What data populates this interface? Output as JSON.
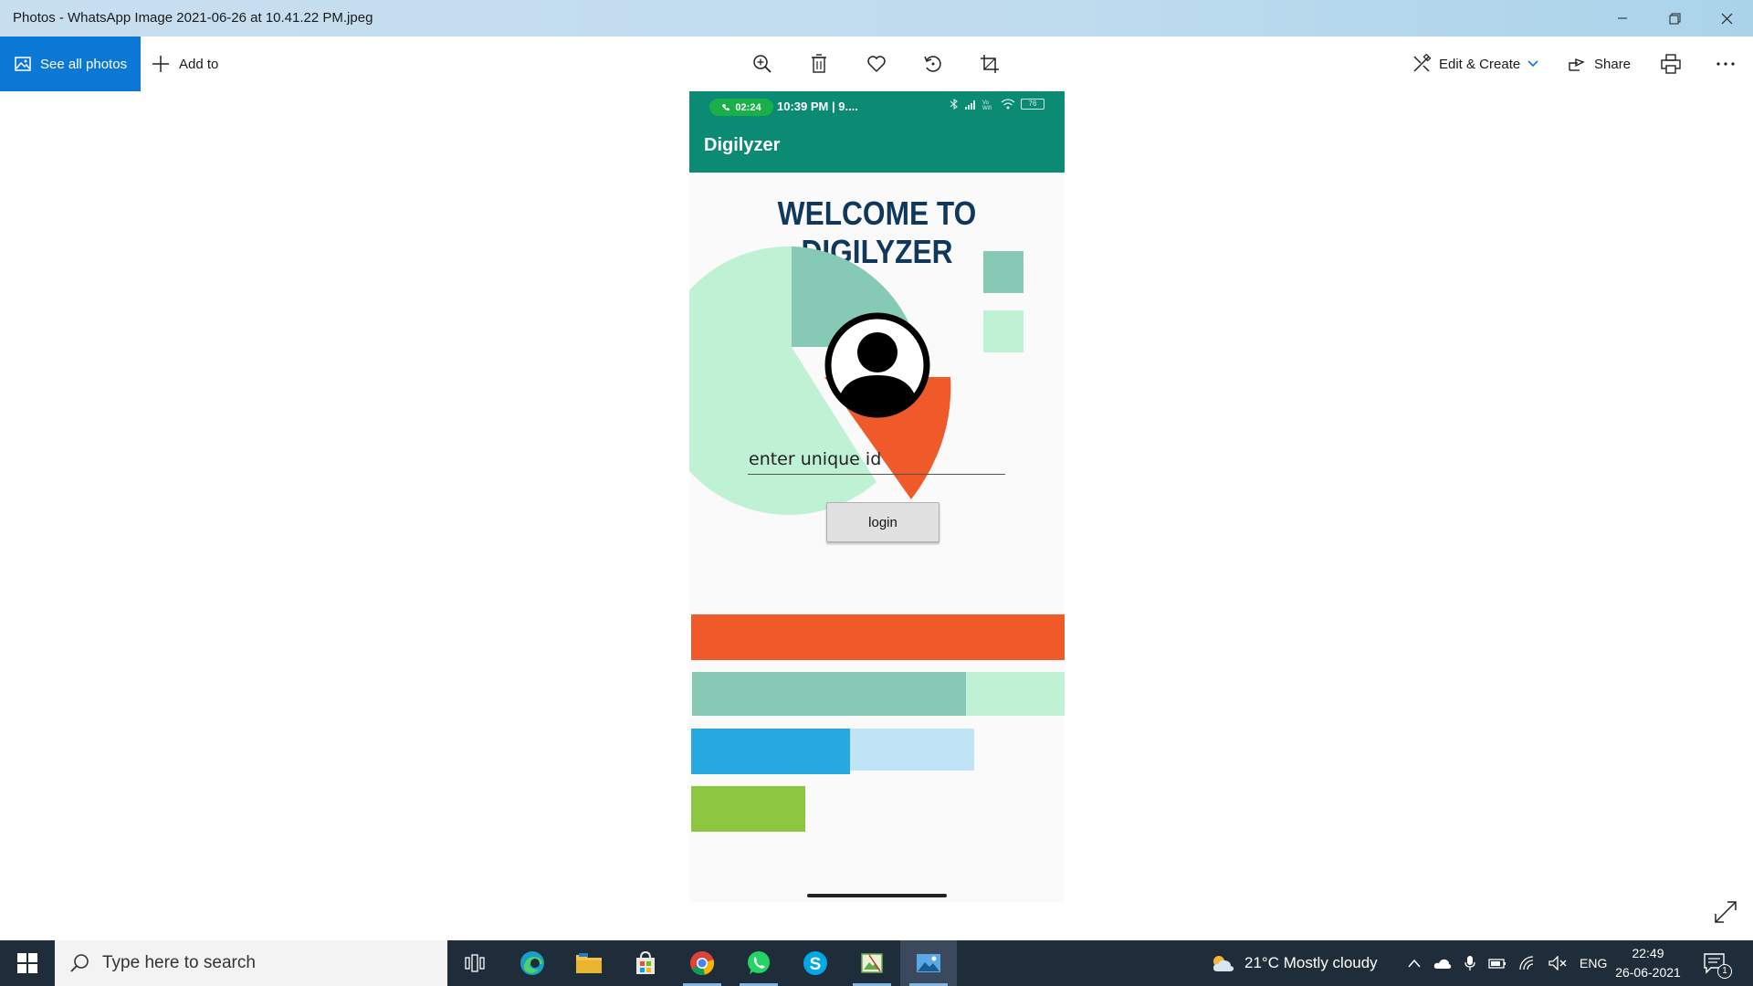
{
  "window": {
    "title": "Photos - WhatsApp Image 2021-06-26 at 10.41.22 PM.jpeg"
  },
  "toolbar": {
    "see_all_photos": "See all photos",
    "add_to": "Add to",
    "edit_create": "Edit & Create",
    "share": "Share"
  },
  "phone": {
    "call_timer": "02:24",
    "status_time": "10:39 PM | 9....",
    "battery": "76",
    "app_title": "Digilyzer",
    "welcome": "WELCOME TO DIGILYZER",
    "uid_placeholder": "enter unique id",
    "login_label": "login",
    "colors": {
      "teal": "#0b8a74",
      "orange": "#f05a2a",
      "mint": "#86c9b4",
      "light_mint": "#bff2d4",
      "blue": "#27a8e0",
      "light_blue": "#bfe4f6",
      "green": "#8dc641",
      "navy": "#10375c"
    }
  },
  "taskbar": {
    "search_placeholder": "Type here to search",
    "weather": "21°C  Mostly cloudy",
    "language": "ENG",
    "time": "22:49",
    "date": "26-06-2021",
    "notifications": "1"
  }
}
